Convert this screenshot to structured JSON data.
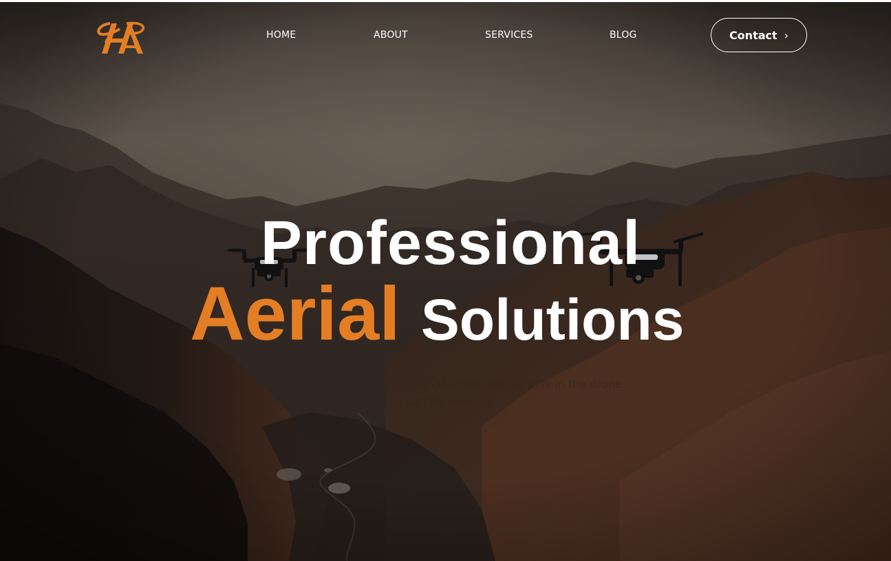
{
  "brand": {
    "logo_text": "HA",
    "accent": "#e37e24"
  },
  "nav": {
    "items": [
      {
        "label": "HOME"
      },
      {
        "label": "ABOUT"
      },
      {
        "label": "SERVICES"
      },
      {
        "label": "BLOG"
      }
    ],
    "contact_label": "Contact",
    "contact_icon": "chevron-right-icon"
  },
  "hero": {
    "line1": "Professional",
    "line2_accent": "Aerial",
    "line2_rest": "Solutions",
    "subtitle": "We at Hartley Aerial cherish the role that we play in the drone service industry.",
    "background": "mountain-landscape-photo",
    "images": [
      "drone-left",
      "drone-right"
    ]
  }
}
